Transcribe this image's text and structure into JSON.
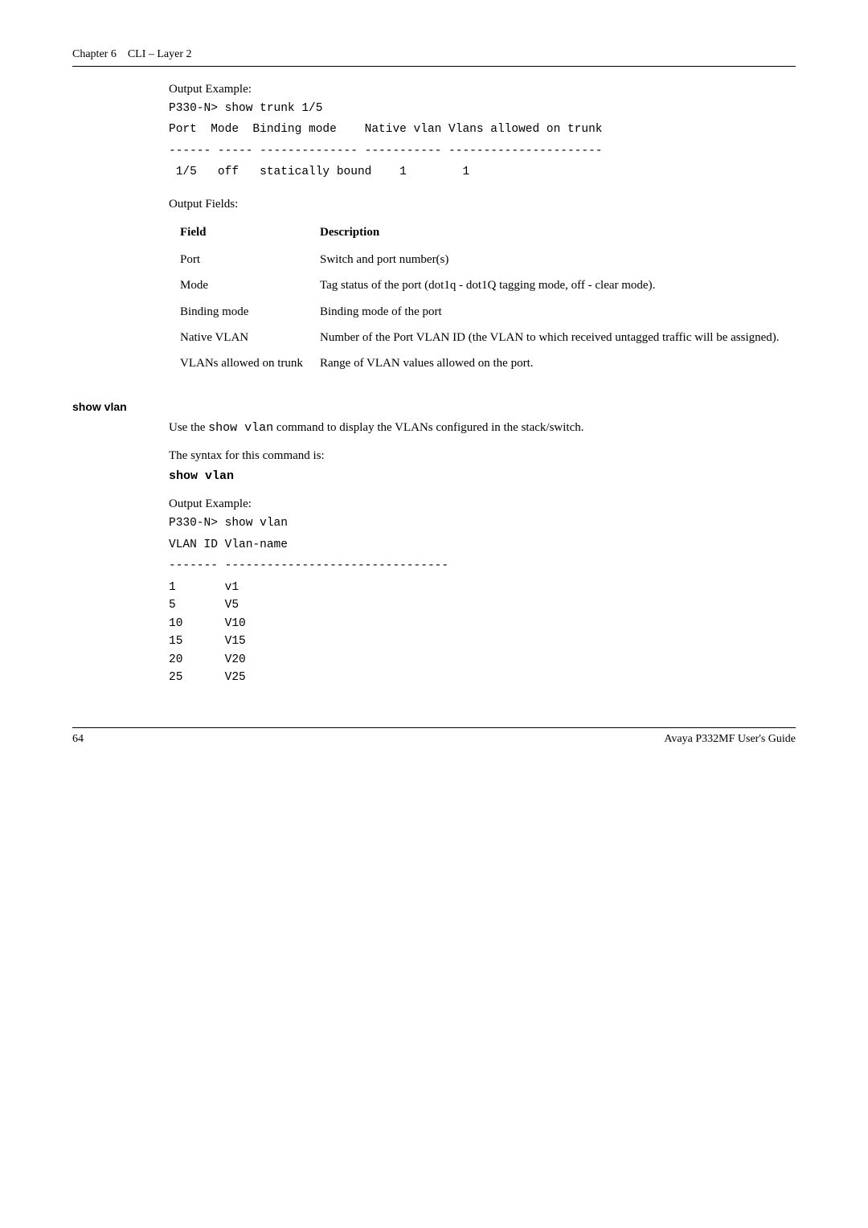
{
  "header": {
    "chapter": "Chapter 6",
    "title": "CLI – Layer 2"
  },
  "section1": {
    "outputExampleLabel": "Output Example:",
    "cmdLine": "P330-N> show trunk 1/5",
    "hdrLine": "Port  Mode  Binding mode    Native vlan Vlans allowed on trunk",
    "dashLine": "------ ----- -------------- ----------- ----------------------",
    "dataLine": " 1/5   off   statically bound    1        1"
  },
  "fields": {
    "label": "Output Fields:",
    "head": {
      "c1": "Field",
      "c2": "Description"
    },
    "rows": [
      {
        "c1": "Port",
        "c2": "Switch and port number(s)"
      },
      {
        "c1": " Mode",
        "c2": "Tag status of the port (dot1q - dot1Q tagging mode, off - clear mode)."
      },
      {
        "c1": "Binding mode",
        "c2": "Binding mode of the port"
      },
      {
        "c1": " Native VLAN",
        "c2": "Number of the Port VLAN ID (the VLAN to which received untagged traffic will be assigned)."
      },
      {
        "c1": "VLANs allowed on trunk",
        "c2": "Range of VLAN values allowed on the port."
      }
    ]
  },
  "showVlan": {
    "heading": "show vlan",
    "desc1a": "Use the ",
    "desc1b": "show vlan",
    "desc1c": " command to display the VLANs configured in the stack/switch.",
    "syntaxLabel": "The syntax for this command is:",
    "syntaxCmd": "show vlan",
    "outputExampleLabel": "Output Example:",
    "line1": "P330-N> show vlan",
    "line2": "VLAN ID Vlan-name",
    "line3": "------- --------------------------------",
    "rows": [
      {
        "id": "1",
        "name": "v1"
      },
      {
        "id": "5",
        "name": "V5"
      },
      {
        "id": "10",
        "name": "V10"
      },
      {
        "id": "15",
        "name": "V15"
      },
      {
        "id": "20",
        "name": "V20"
      },
      {
        "id": "25",
        "name": "V25"
      }
    ]
  },
  "footer": {
    "page": "64",
    "guide": "Avaya P332MF User's Guide"
  }
}
